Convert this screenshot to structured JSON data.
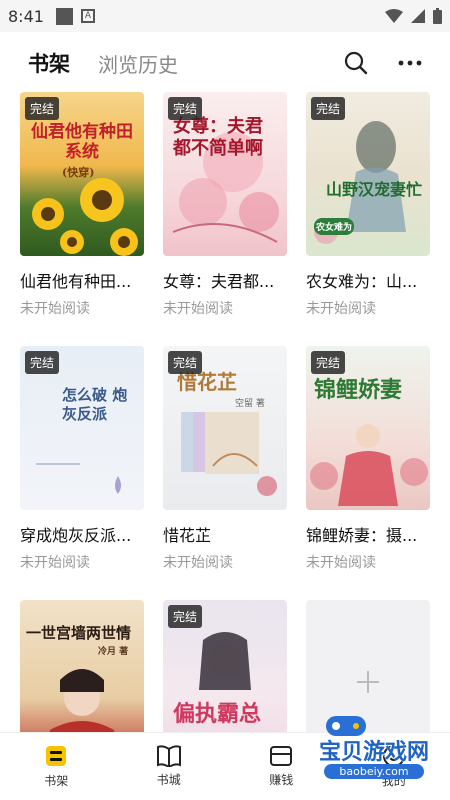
{
  "status_bar": {
    "time": "8:41"
  },
  "header": {
    "tabs": [
      {
        "label": "书架",
        "active": true
      },
      {
        "label": "浏览历史",
        "active": false
      }
    ]
  },
  "books": [
    {
      "title": "仙君他有种田...",
      "status": "未开始阅读",
      "badge": "完结",
      "cover_text": "仙君他有种田系统",
      "cover_sub": "(快穿)"
    },
    {
      "title": "女尊：夫君都...",
      "status": "未开始阅读",
      "badge": "完结",
      "cover_text": "女尊：夫君都不简单啊"
    },
    {
      "title": "农女难为：山...",
      "status": "未开始阅读",
      "badge": "完结",
      "cover_text": "山野汉宠妻忙",
      "cover_sub": "农女难为"
    },
    {
      "title": "穿成炮灰反派...",
      "status": "未开始阅读",
      "badge": "完结",
      "cover_text": "怎么破 炮灰反派"
    },
    {
      "title": "惜花芷",
      "status": "未开始阅读",
      "badge": "完结",
      "cover_text": "惜花芷",
      "cover_sub": "空留 著"
    },
    {
      "title": "锦鲤娇妻：摄...",
      "status": "未开始阅读",
      "badge": "完结",
      "cover_text": "锦鲤娇妻"
    },
    {
      "title": "",
      "status": "",
      "badge": "",
      "cover_text": "一世宫墙两世情",
      "cover_sub": "冷月 著"
    },
    {
      "title": "",
      "status": "",
      "badge": "完结",
      "cover_text": "偏执霸总"
    }
  ],
  "add_card": {
    "icon": "plus-icon"
  },
  "bottom_nav": [
    {
      "label": "书架",
      "icon": "bookshelf-icon",
      "active": true
    },
    {
      "label": "书城",
      "icon": "book-icon",
      "active": false
    },
    {
      "label": "赚钱",
      "icon": "wallet-icon",
      "active": false
    },
    {
      "label": "我的",
      "icon": "profile-icon",
      "active": false
    }
  ],
  "watermark": {
    "text": "宝贝游戏网",
    "url": "baobeiy.com"
  },
  "colors": {
    "accent": "#f5c400",
    "badge_bg": "#2c2c2c",
    "muted": "#999999"
  }
}
